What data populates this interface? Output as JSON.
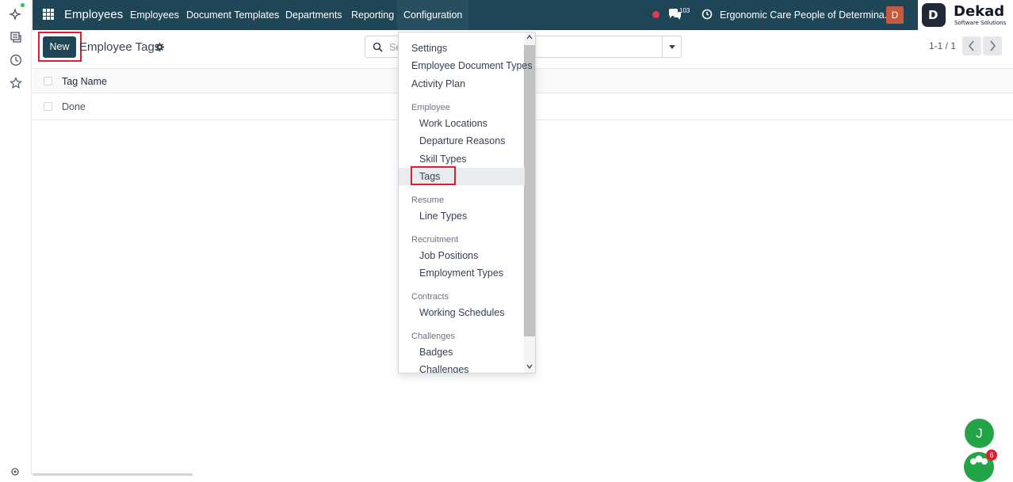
{
  "topbar": {
    "app_name": "Employees",
    "nav": [
      "Employees",
      "Document Templates",
      "Departments",
      "Reporting",
      "Configuration"
    ],
    "active_nav": "Configuration",
    "message_count": "103",
    "company": "Ergonomic Care People of Determina...",
    "user_initial": "D",
    "brand_name": "Dekad",
    "brand_tagline": "Software Solutions",
    "brand_initial": "D"
  },
  "control": {
    "new_label": "New",
    "title": "Employee Tags",
    "search_placeholder": "Se",
    "pager": "1-1 / 1"
  },
  "list": {
    "column": "Tag Name",
    "rows": [
      "Done"
    ]
  },
  "menu": {
    "items": [
      {
        "type": "item",
        "label": "Settings"
      },
      {
        "type": "item",
        "label": "Employee Document Types"
      },
      {
        "type": "item",
        "label": "Activity Plan"
      },
      {
        "type": "header",
        "label": "Employee"
      },
      {
        "type": "sub",
        "label": "Work Locations"
      },
      {
        "type": "sub",
        "label": "Departure Reasons"
      },
      {
        "type": "sub",
        "label": "Skill Types"
      },
      {
        "type": "sub",
        "label": "Tags",
        "selected": true
      },
      {
        "type": "header",
        "label": "Resume"
      },
      {
        "type": "sub",
        "label": "Line Types"
      },
      {
        "type": "header",
        "label": "Recruitment"
      },
      {
        "type": "sub",
        "label": "Job Positions"
      },
      {
        "type": "sub",
        "label": "Employment Types"
      },
      {
        "type": "header",
        "label": "Contracts"
      },
      {
        "type": "sub",
        "label": "Working Schedules"
      },
      {
        "type": "header",
        "label": "Challenges"
      },
      {
        "type": "sub",
        "label": "Badges"
      },
      {
        "type": "sub",
        "label": "Challenges"
      }
    ]
  },
  "chat": {
    "user_initial": "J",
    "unread_count": "6"
  },
  "colors": {
    "nav_bg": "#1f4656",
    "highlight": "#e11d2c",
    "online": "#22c55e",
    "chat_green": "#22a447"
  },
  "icons": [
    "apps-grid-icon",
    "chat-icon",
    "clock-icon",
    "gear-icon",
    "search-icon",
    "chevron-left-icon",
    "chevron-right-icon",
    "sparkle-icon",
    "inbox-icon",
    "history-icon",
    "star-icon",
    "settings-icon"
  ]
}
